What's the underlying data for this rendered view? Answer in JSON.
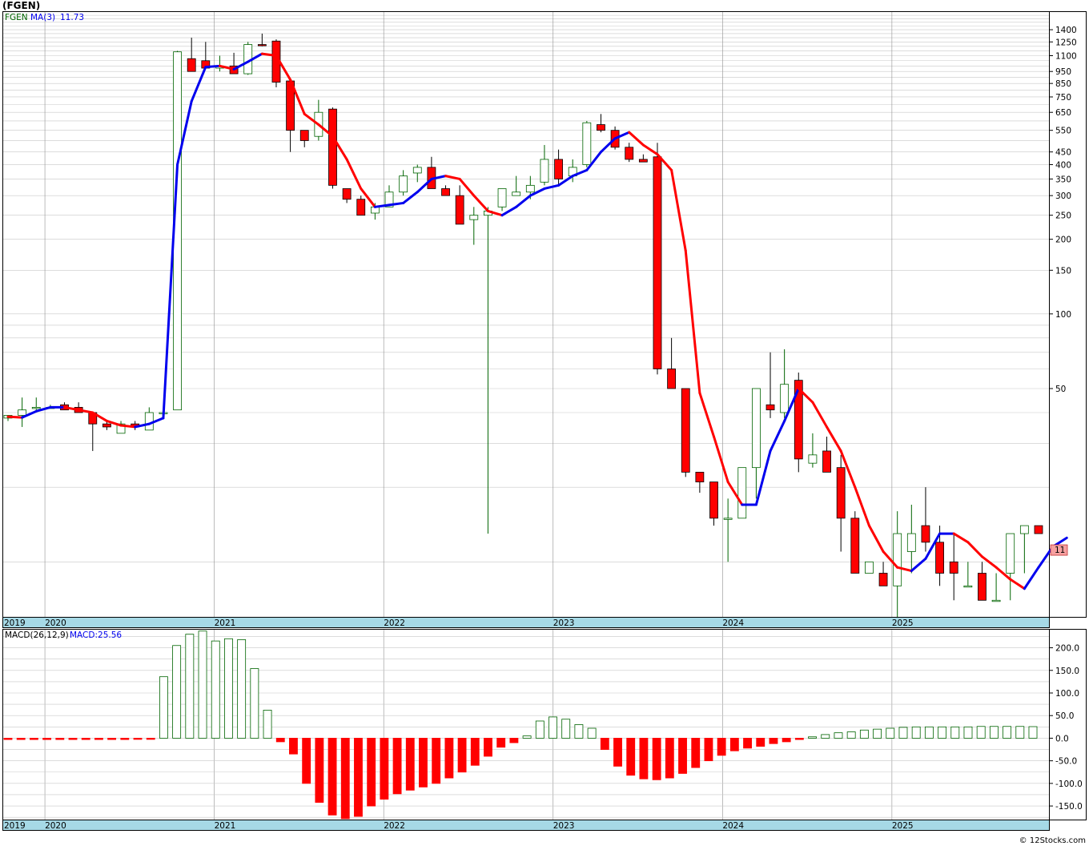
{
  "title": "(FGEN)",
  "footer": "© 12Stocks.com",
  "colors": {
    "up": "#006400",
    "down": "#ff0000",
    "ma_up": "#0000ee",
    "ma_down": "#ff0000",
    "axis_band": "#a6d9e6",
    "grid": "#c8c8c8"
  },
  "chart_data": [
    {
      "type": "candlestick",
      "symbol_label": "FGEN",
      "ma_label": "MA(3)",
      "ma_value_label": "11.73",
      "last_price_label": "11",
      "scale": "log",
      "ylim": [
        6,
        1650
      ],
      "y_ticks": [
        "1400",
        "1250",
        "1100",
        "950",
        "850",
        "750",
        "650",
        "550",
        "450",
        "400",
        "350",
        "300",
        "250",
        "200",
        "150",
        "100",
        "50"
      ],
      "year_labels": [
        "2019",
        "2020",
        "2021",
        "2022",
        "2023",
        "2024",
        "2025"
      ],
      "year_positions": [
        0,
        3,
        15,
        27,
        39,
        51,
        63
      ],
      "ohlc": [
        [
          38,
          39,
          37,
          39
        ],
        [
          39,
          46,
          35,
          41
        ],
        [
          42,
          46,
          41,
          42
        ],
        [
          42,
          43,
          42,
          42
        ],
        [
          43,
          44,
          41,
          41
        ],
        [
          42,
          44,
          40,
          40
        ],
        [
          40,
          40,
          28,
          36
        ],
        [
          36,
          37,
          34,
          35
        ],
        [
          33,
          37,
          33,
          36
        ],
        [
          36,
          37,
          34,
          35
        ],
        [
          34,
          42,
          34,
          40
        ],
        [
          40,
          40,
          40,
          40
        ],
        [
          41,
          1150,
          41,
          1140
        ],
        [
          1070,
          1300,
          950,
          950
        ],
        [
          1050,
          1250,
          990,
          980
        ],
        [
          980,
          1100,
          950,
          1000
        ],
        [
          1000,
          1130,
          960,
          930
        ],
        [
          930,
          1250,
          920,
          1220
        ],
        [
          1220,
          1350,
          1200,
          1210
        ],
        [
          1260,
          1280,
          820,
          860
        ],
        [
          870,
          880,
          450,
          550
        ],
        [
          550,
          540,
          470,
          500
        ],
        [
          520,
          730,
          500,
          650
        ],
        [
          670,
          680,
          320,
          330
        ],
        [
          320,
          320,
          280,
          290
        ],
        [
          290,
          300,
          250,
          250
        ],
        [
          255,
          280,
          240,
          270
        ],
        [
          270,
          330,
          270,
          310
        ],
        [
          310,
          380,
          300,
          360
        ],
        [
          370,
          400,
          340,
          390
        ],
        [
          390,
          430,
          350,
          320
        ],
        [
          320,
          330,
          300,
          300
        ],
        [
          300,
          330,
          230,
          230
        ],
        [
          240,
          270,
          190,
          250
        ],
        [
          250,
          270,
          13,
          260
        ],
        [
          270,
          320,
          260,
          320
        ],
        [
          300,
          360,
          300,
          310
        ],
        [
          310,
          360,
          290,
          330
        ],
        [
          340,
          480,
          330,
          420
        ],
        [
          420,
          460,
          330,
          350
        ],
        [
          360,
          420,
          340,
          390
        ],
        [
          400,
          600,
          390,
          590
        ],
        [
          580,
          640,
          540,
          550
        ],
        [
          550,
          570,
          460,
          470
        ],
        [
          470,
          490,
          410,
          420
        ],
        [
          420,
          440,
          410,
          410
        ],
        [
          430,
          490,
          57,
          60
        ],
        [
          60,
          80,
          50,
          50
        ],
        [
          50,
          50,
          22,
          23
        ],
        [
          23,
          23,
          19,
          21
        ],
        [
          21,
          21,
          14,
          15
        ],
        [
          15,
          18,
          10,
          15
        ],
        [
          15,
          24,
          15,
          24
        ],
        [
          24,
          50,
          18,
          50
        ],
        [
          43,
          70,
          38,
          41
        ],
        [
          40,
          72,
          38,
          52
        ],
        [
          54,
          58,
          23,
          26
        ],
        [
          25,
          33,
          24,
          27
        ],
        [
          28,
          32,
          23,
          23
        ],
        [
          24,
          27,
          11,
          15
        ],
        [
          15,
          16,
          9,
          9
        ],
        [
          9,
          10,
          9,
          10
        ],
        [
          9,
          10,
          8,
          8
        ],
        [
          8,
          16,
          6,
          13
        ],
        [
          11,
          17,
          9,
          13
        ],
        [
          14,
          20,
          11,
          12
        ],
        [
          12,
          14,
          8,
          9
        ],
        [
          10,
          13,
          7,
          9
        ],
        [
          8,
          10,
          8,
          8
        ],
        [
          9,
          10,
          7,
          7
        ],
        [
          7,
          9,
          7,
          7
        ],
        [
          9,
          13,
          7,
          13
        ],
        [
          13,
          14,
          9,
          14
        ],
        [
          14,
          14,
          13,
          13
        ]
      ],
      "ma_values": [
        38.5,
        38.2,
        40.5,
        42,
        42,
        41,
        40,
        37,
        35.5,
        35,
        36,
        38,
        400,
        720,
        990,
        1000,
        970,
        1040,
        1120,
        1100,
        880,
        640,
        580,
        520,
        420,
        320,
        270,
        275,
        280,
        310,
        350,
        360,
        350,
        300,
        260,
        250,
        270,
        300,
        320,
        330,
        360,
        380,
        450,
        510,
        540,
        480,
        440,
        380,
        180,
        48,
        32,
        21,
        17,
        17,
        28,
        37,
        50,
        44,
        35,
        28,
        20,
        14,
        11,
        9.5,
        9.2,
        10.3,
        13,
        13,
        12,
        10.5,
        9.5,
        8.5,
        7.8,
        9.5,
        11.5,
        12.5
      ]
    },
    {
      "type": "bar",
      "label": "MACD(26,12,9)",
      "value_label": "MACD:25.56",
      "ylim": [
        -180,
        240
      ],
      "y_ticks": [
        "200.0",
        "150.0",
        "100.0",
        "50.0",
        "0.0",
        "-50.0",
        "-100.0",
        "-150.0"
      ],
      "y_tick_values": [
        200,
        150,
        100,
        50,
        0,
        -50,
        -100,
        -150
      ],
      "year_labels": [
        "2019",
        "2020",
        "2021",
        "2022",
        "2023",
        "2024",
        "2025"
      ],
      "values": [
        -3,
        -3,
        -3,
        -3,
        -3,
        -3,
        -3,
        -3,
        -3,
        -3,
        -2,
        -1,
        136,
        205,
        230,
        237,
        215,
        220,
        218,
        154,
        62,
        -8,
        -35,
        -100,
        -142,
        -170,
        -178,
        -173,
        -150,
        -135,
        -123,
        -115,
        -108,
        -100,
        -88,
        -75,
        -60,
        -40,
        -20,
        -10,
        5,
        38,
        47,
        42,
        30,
        22,
        -25,
        -62,
        -82,
        -90,
        -92,
        -88,
        -78,
        -65,
        -50,
        -38,
        -28,
        -22,
        -18,
        -12,
        -8,
        -3,
        3,
        8,
        12,
        14,
        18,
        20,
        22,
        24,
        25,
        25,
        25,
        25,
        25,
        26,
        26,
        26,
        26,
        25.56
      ]
    }
  ]
}
